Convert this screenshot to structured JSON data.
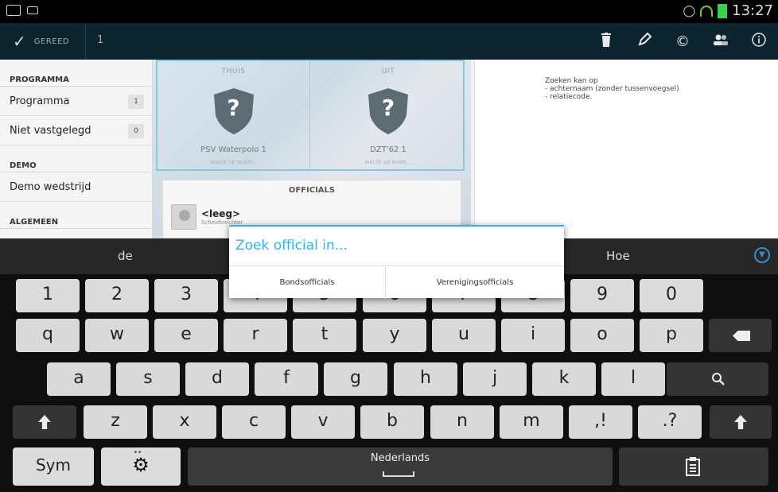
{
  "status_bar": {
    "time": "13:27",
    "icons": [
      "image-icon",
      "keyboard-icon",
      "eye-icon",
      "wifi-icon",
      "battery-icon"
    ]
  },
  "action_bar": {
    "done_label": "GEREED",
    "count": "1",
    "actions": [
      "trash-icon",
      "pencil-icon",
      "copyright-icon",
      "users-icon",
      "info-icon"
    ]
  },
  "sidebar": {
    "sections": [
      {
        "header": "PROGRAMMA",
        "items": [
          {
            "label": "Programma",
            "badge": "1"
          },
          {
            "label": "Niet vastgelegd",
            "badge": "0"
          }
        ]
      },
      {
        "header": "DEMO",
        "items": [
          {
            "label": "Demo wedstrijd",
            "badge": ""
          }
        ]
      },
      {
        "header": "ALGEMEEN",
        "items": []
      }
    ]
  },
  "match": {
    "home_label": "THUIS",
    "away_label": "UIT",
    "home_team": "PSV Waterpolo 1",
    "away_team": "DZT'62 1",
    "home_status": "wacht op team...",
    "away_status": "wacht op team...",
    "officials_title": "OFFICIALS",
    "official_name": "<leeg>",
    "official_role": "Scheidsrechter"
  },
  "info": {
    "lines": [
      "Zoeken kan op",
      "- achternaam (zonder tussenvoegsel)",
      "- relatiecode."
    ]
  },
  "suggestions": [
    "de",
    "Hoe"
  ],
  "keyboard": {
    "numbers": [
      "1",
      "2",
      "3",
      "4",
      "5",
      "6",
      "7",
      "8",
      "9",
      "0"
    ],
    "row1": [
      "q",
      "w",
      "e",
      "r",
      "t",
      "y",
      "u",
      "i",
      "o",
      "p"
    ],
    "row2": [
      "a",
      "s",
      "d",
      "f",
      "g",
      "h",
      "j",
      "k",
      "l"
    ],
    "row3": [
      "z",
      "x",
      "c",
      "v",
      "b",
      "n",
      "m"
    ],
    "comma_label": ",!",
    "period_label": ".?",
    "sym_label": "Sym",
    "space_label": "Nederlands"
  },
  "dialog": {
    "title": "Zoek official in...",
    "button_left": "Bondsofficials",
    "button_right": "Verenigingsofficials"
  },
  "colors": {
    "accent": "#33b5e5",
    "action_bar": "#0b2430",
    "shield": "#5d6b75",
    "battery": "#38d14a"
  }
}
